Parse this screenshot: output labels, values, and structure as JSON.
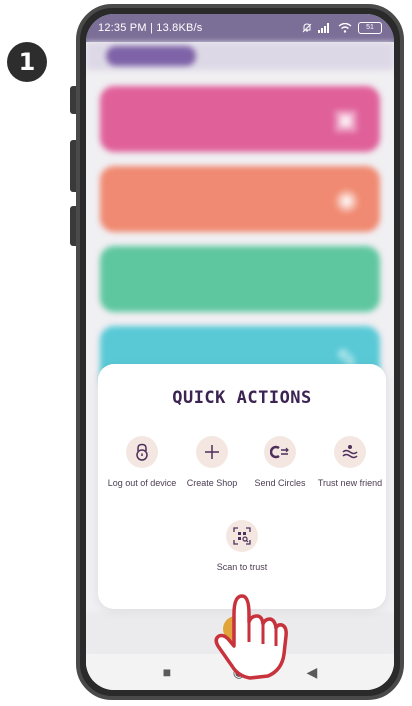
{
  "step": {
    "number": "1"
  },
  "status_bar": {
    "time_text": "12:35 PM | 13.8KB/s",
    "battery_text": "51",
    "icons": [
      "mute-icon",
      "signal-icon",
      "wifi-icon",
      "battery-icon"
    ]
  },
  "quick_actions": {
    "title": "QUICK ACTIONS",
    "items": [
      {
        "label": "Log out of device",
        "icon": "lock-icon"
      },
      {
        "label": "Create Shop",
        "icon": "plus-icon"
      },
      {
        "label": "Send Circles",
        "icon": "send-circles-icon"
      },
      {
        "label": "Trust new friend",
        "icon": "trust-friend-icon"
      },
      {
        "label": "Scan to trust",
        "icon": "qr-scan-icon"
      }
    ]
  },
  "background_cards": {
    "colors": [
      "#e0619a",
      "#f08a72",
      "#5fc7a0",
      "#59c9d6"
    ]
  },
  "navigation": {
    "icons": [
      "recent-apps-icon",
      "home-icon",
      "back-icon"
    ]
  },
  "colors": {
    "title": "#3b2452",
    "icon_bg": "#f4e7e1",
    "status_bar": "#7b6f98",
    "accent": "#e0a43a"
  }
}
